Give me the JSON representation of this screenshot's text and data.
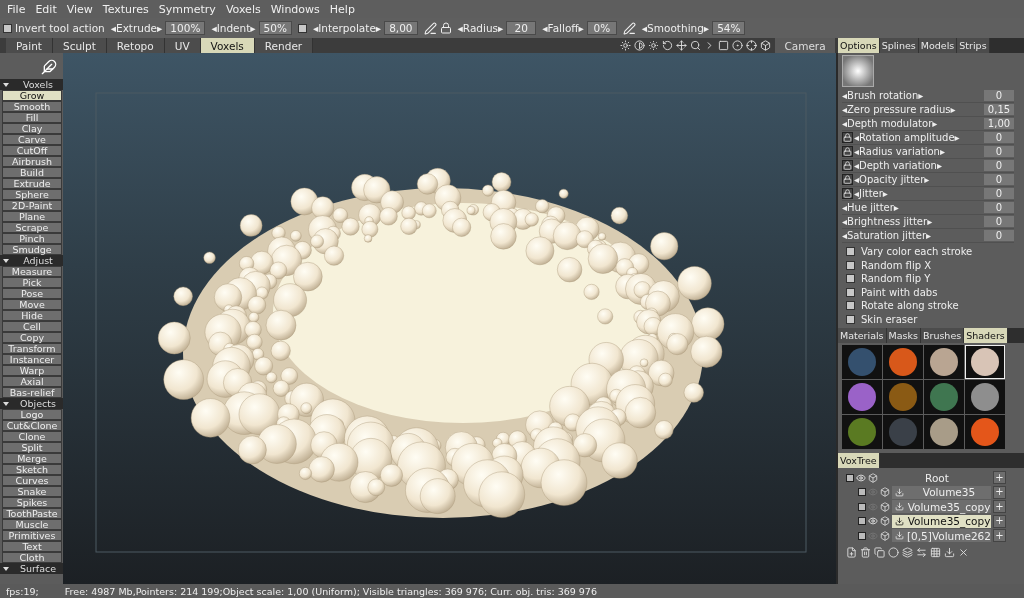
{
  "menu": [
    "File",
    "Edit",
    "View",
    "Textures",
    "Symmetry",
    "Voxels",
    "Windows",
    "Help"
  ],
  "toolbar": [
    {
      "kind": "checkbox",
      "label": "Invert tool action",
      "checked": false
    },
    {
      "kind": "field",
      "label": "◂Extrude▸",
      "value": "100%"
    },
    {
      "kind": "field",
      "label": "◂Indent▸",
      "value": "50%"
    },
    {
      "kind": "checkbox",
      "checked": false
    },
    {
      "kind": "field",
      "label": "◂Interpolate▸",
      "value": "8,00"
    },
    {
      "kind": "pen-lock"
    },
    {
      "kind": "field",
      "label": "◂Radius▸",
      "value": "20"
    },
    {
      "kind": "field",
      "label": "◂Falloff▸",
      "value": "0%"
    },
    {
      "kind": "pen"
    },
    {
      "kind": "field",
      "label": "◂Smoothing▸",
      "value": "54%"
    }
  ],
  "room_tabs": [
    {
      "label": "Paint",
      "selected": false
    },
    {
      "label": "Sculpt",
      "selected": false
    },
    {
      "label": "Retopo",
      "selected": false
    },
    {
      "label": "UV",
      "selected": false
    },
    {
      "label": "Voxels",
      "selected": true
    },
    {
      "label": "Render",
      "selected": false
    }
  ],
  "camera_button": "Camera",
  "tools": [
    {
      "section": "Voxels",
      "items": [
        {
          "label": "Grow",
          "selected": true
        },
        {
          "label": "Smooth",
          "selected": false
        },
        {
          "label": "Fill",
          "selected": false
        },
        {
          "label": "Clay",
          "selected": false
        },
        {
          "label": "Carve",
          "selected": false
        },
        {
          "label": "CutOff",
          "selected": false
        },
        {
          "label": "Airbrush",
          "selected": false
        },
        {
          "label": "Build",
          "selected": false
        },
        {
          "label": "Extrude",
          "selected": false
        },
        {
          "label": "Sphere",
          "selected": false
        },
        {
          "label": "2D-Paint",
          "selected": false
        },
        {
          "label": "Plane",
          "selected": false
        },
        {
          "label": "Scrape",
          "selected": false
        },
        {
          "label": "Pinch",
          "selected": false
        },
        {
          "label": "Smudge",
          "selected": false
        }
      ]
    },
    {
      "section": "Adjust",
      "items": [
        {
          "label": "Measure",
          "selected": false
        },
        {
          "label": "Pick",
          "selected": false
        },
        {
          "label": "Pose",
          "selected": false
        },
        {
          "label": "Move",
          "selected": false
        },
        {
          "label": "Hide",
          "selected": false
        },
        {
          "label": "Cell",
          "selected": false
        },
        {
          "label": "Copy",
          "selected": false
        },
        {
          "label": "Transform",
          "selected": false
        },
        {
          "label": "Instancer",
          "selected": false
        },
        {
          "label": "Warp",
          "selected": false
        },
        {
          "label": "Axial",
          "selected": false
        },
        {
          "label": "Bas-relief",
          "selected": false
        }
      ]
    },
    {
      "section": "Objects",
      "items": [
        {
          "label": "Logo",
          "selected": false
        },
        {
          "label": "Cut&Clone",
          "selected": false
        },
        {
          "label": "Clone",
          "selected": false
        },
        {
          "label": "Split",
          "selected": false
        },
        {
          "label": "Merge",
          "selected": false
        },
        {
          "label": "Sketch",
          "selected": false
        },
        {
          "label": "Curves",
          "selected": false
        },
        {
          "label": "Snake",
          "selected": false
        },
        {
          "label": "Spikes",
          "selected": false
        },
        {
          "label": "ToothPaste",
          "selected": false
        },
        {
          "label": "Muscle",
          "selected": false
        },
        {
          "label": "Primitives",
          "selected": false
        },
        {
          "label": "Text",
          "selected": false
        },
        {
          "label": "Cloth",
          "selected": false
        }
      ]
    },
    {
      "section": "Surface"
    }
  ],
  "options_tabs": [
    {
      "label": "Options",
      "selected": true
    },
    {
      "label": "Splines",
      "selected": false
    },
    {
      "label": "Models",
      "selected": false
    },
    {
      "label": "Strips",
      "selected": false
    }
  ],
  "params": [
    {
      "label": "◂Brush rotation▸",
      "value": "0",
      "locked": false
    },
    {
      "label": "◂Zero pressure radius▸",
      "value": "0,15",
      "locked": false
    },
    {
      "label": "◂Depth modulator▸",
      "value": "1,00",
      "locked": false
    },
    {
      "label": "◂Rotation amplitude▸",
      "value": "0",
      "locked": true
    },
    {
      "label": "◂Radius variation▸",
      "value": "0",
      "locked": true
    },
    {
      "label": "◂Depth variation▸",
      "value": "0",
      "locked": true
    },
    {
      "label": "◂Opacity jitter▸",
      "value": "0",
      "locked": true
    },
    {
      "label": "◂Jitter▸",
      "value": "0",
      "locked": true
    },
    {
      "label": "◂Hue jitter▸",
      "value": "0",
      "locked": false
    },
    {
      "label": "◂Brightness jitter▸",
      "value": "0",
      "locked": false
    },
    {
      "label": "◂Saturation jitter▸",
      "value": "0",
      "locked": false
    }
  ],
  "options": [
    {
      "label": "Vary color each stroke",
      "checked": false
    },
    {
      "label": "Random flip X",
      "checked": false
    },
    {
      "label": "Random flip Y",
      "checked": false
    },
    {
      "label": "Paint with dabs",
      "checked": false
    },
    {
      "label": "Rotate along stroke",
      "checked": false
    },
    {
      "label": "Skin eraser",
      "checked": false
    }
  ],
  "library_tabs": [
    {
      "label": "Materials",
      "selected": false
    },
    {
      "label": "Masks",
      "selected": false
    },
    {
      "label": "Brushes",
      "selected": false
    },
    {
      "label": "Shaders",
      "selected": true
    }
  ],
  "shaders": [
    {
      "color": "#34506e",
      "selected": false
    },
    {
      "color": "#d8581a",
      "selected": false
    },
    {
      "color": "#b9a592",
      "selected": false
    },
    {
      "color": "#d8c4b6",
      "selected": true
    },
    {
      "color": "#9a62c8",
      "selected": false
    },
    {
      "color": "#8a5a14",
      "selected": false
    },
    {
      "color": "#3f7650",
      "selected": false
    },
    {
      "color": "#8e8e8e",
      "selected": false
    },
    {
      "color": "#5a7a22",
      "selected": false
    },
    {
      "color": "#3a4048",
      "selected": false
    },
    {
      "color": "#a89c88",
      "selected": false
    },
    {
      "color": "#e4561a",
      "selected": false
    }
  ],
  "voxtree_tab": "VoxTree",
  "voxtree": {
    "name": "Root",
    "add": "+",
    "selected": false,
    "visible": true,
    "children": [
      {
        "name": "Volume35",
        "add": "+",
        "selected": false,
        "visible": false
      },
      {
        "name": "Volume35_copy",
        "add": "+",
        "selected": false,
        "visible": false
      },
      {
        "name": "Volume35_copy",
        "add": "+",
        "selected": true,
        "visible": true
      },
      {
        "name": "[0,5]Volume262",
        "add": "+",
        "selected": false,
        "visible": false
      }
    ]
  },
  "status": {
    "fps": "fps:19;",
    "info": "Free: 4987 Mb,Pointers: 214 199;Object scale: 1,00 (Uniform); Visible triangles: 369 976; Curr. obj. tris: 369 976"
  }
}
